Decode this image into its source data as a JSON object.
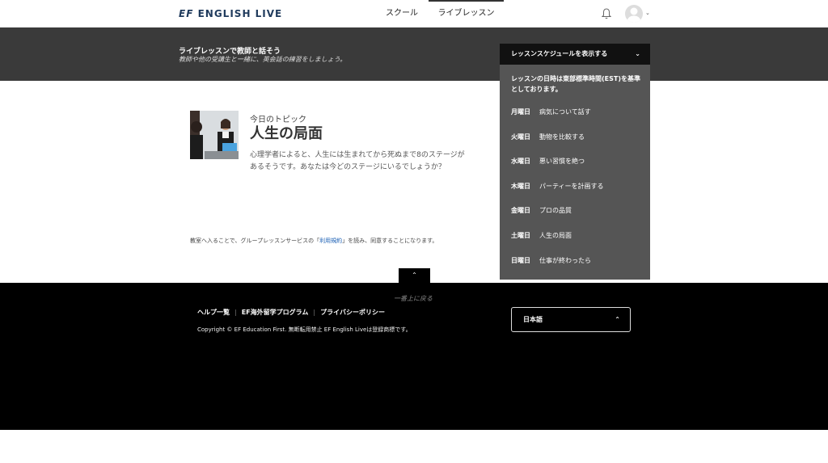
{
  "nav": {
    "logo_ef": "EF",
    "logo_text": "ENGLISH LIVE",
    "tabs": [
      {
        "label": "スクール"
      },
      {
        "label": "ライブレッスン"
      }
    ]
  },
  "banner": {
    "title": "ライブレッスンで教師と話そう",
    "subtitle": "教師や他の受講生と一緒に、英会話の練習をしましょう。"
  },
  "topic": {
    "label": "今日のトピック",
    "title": "人生の局面",
    "description": "心理学者によると、人生には生まれてから死ぬまで8のステージがあるそうです。あなたは今どのステージにいるでしょうか？"
  },
  "terms": {
    "before": "教室へ入ることで、グループレッスンサービスの「",
    "link": "利用規約",
    "after": "」を読み、同意することになります。"
  },
  "schedule": {
    "header": "レッスンスケジュールを表示する",
    "note": "レッスンの日時は東部標準時間(EST)を基準としております。",
    "items": [
      {
        "day": "月曜日",
        "topic": "病気について話す"
      },
      {
        "day": "火曜日",
        "topic": "動物を比較する"
      },
      {
        "day": "水曜日",
        "topic": "悪い習慣を絶つ"
      },
      {
        "day": "木曜日",
        "topic": "パーティーを計画する"
      },
      {
        "day": "金曜日",
        "topic": "プロの品質"
      },
      {
        "day": "土曜日",
        "topic": "人生の局面"
      },
      {
        "day": "日曜日",
        "topic": "仕事が終わったら"
      }
    ]
  },
  "back_to_top": "一番上に戻る",
  "footer": {
    "links": [
      "ヘルプ一覧",
      "EF海外留学プログラム",
      "プライバシーポリシー"
    ],
    "copyright": "Copyright © EF Education First. 無断転用禁止 EF English Liveは登録商標です。",
    "language": "日本語"
  }
}
